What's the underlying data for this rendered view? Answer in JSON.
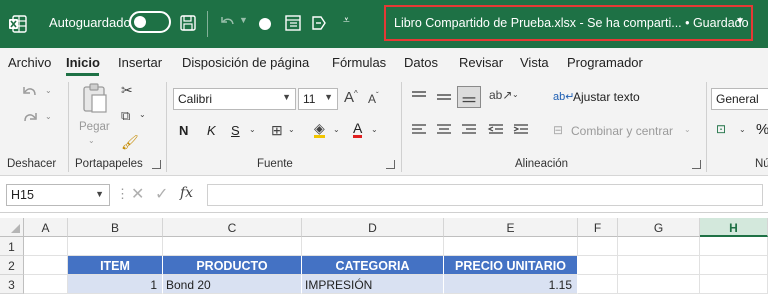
{
  "titlebar": {
    "autosave_label": "Autoguardado",
    "file_title": "Libro Compartido de Prueba.xlsx  -  Se ha comparti...  •  Guardado",
    "caret": "⌄"
  },
  "tabs": [
    "Archivo",
    "Inicio",
    "Insertar",
    "Disposición de página",
    "Fórmulas",
    "Datos",
    "Revisar",
    "Vista",
    "Programador"
  ],
  "ribbon": {
    "undo_label": "Deshacer",
    "paste_label": "Pegar",
    "clipboard_label": "Portapapeles",
    "font_name": "Calibri",
    "font_size": "11",
    "bold": "N",
    "italic": "K",
    "underline": "S",
    "font_color_glyph": "A",
    "font_group_label": "Fuente",
    "wrap_text": "Ajustar texto",
    "merge_center": "Combinar y centrar",
    "alignment_label": "Alineación",
    "number_format": "General",
    "number_partial": "Nú"
  },
  "formula_bar": {
    "cell_ref": "H15",
    "fx": "fx",
    "value": ""
  },
  "grid": {
    "columns": [
      "A",
      "B",
      "C",
      "D",
      "E",
      "F",
      "G",
      "H"
    ],
    "rows": [
      "1",
      "2",
      "3"
    ],
    "header_row": [
      "ITEM",
      "PRODUCTO",
      "CATEGORIA",
      "PRECIO UNITARIO"
    ],
    "data_row": [
      "1",
      "Bond 20",
      "IMPRESIÓN",
      "1.15"
    ]
  },
  "colors": {
    "excel_green": "#1e7145",
    "header_blue": "#4472c4",
    "row_band": "#d9e1f2",
    "highlight_red": "#e53935"
  }
}
